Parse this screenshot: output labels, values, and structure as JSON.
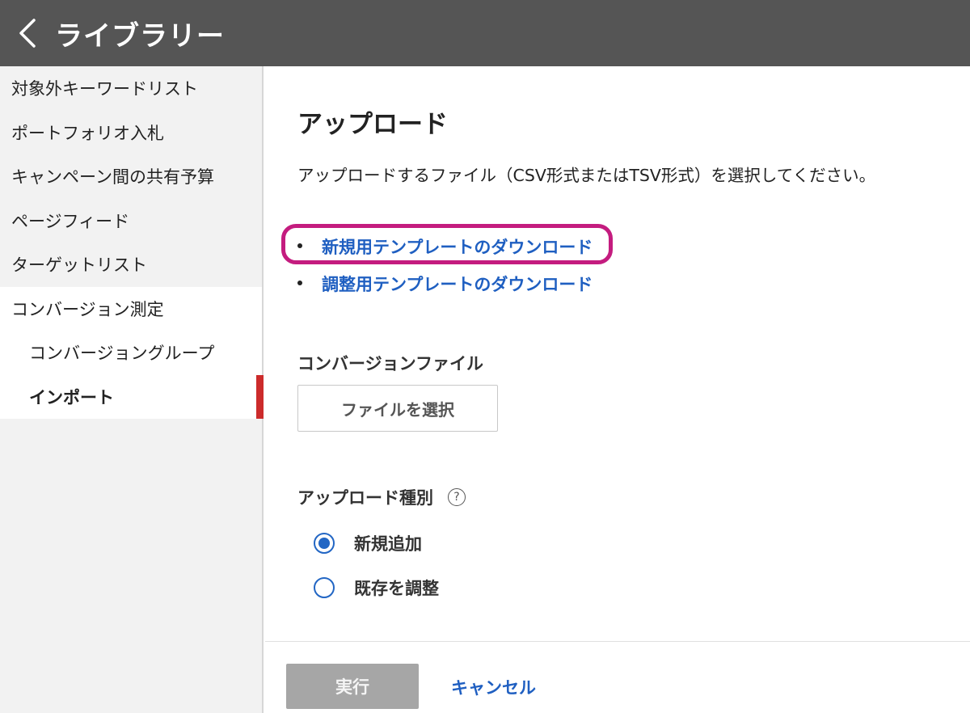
{
  "header": {
    "title": "ライブラリー"
  },
  "sidebar": {
    "items": [
      {
        "label": "対象外キーワードリスト"
      },
      {
        "label": "ポートフォリオ入札"
      },
      {
        "label": "キャンペーン間の共有予算"
      },
      {
        "label": "ページフィード"
      },
      {
        "label": "ターゲットリスト"
      },
      {
        "label": "コンバージョン測定"
      },
      {
        "label": "コンバージョングループ"
      },
      {
        "label": "インポート"
      }
    ],
    "selected_color": "#cc2b2b"
  },
  "main": {
    "title": "アップロード",
    "description": "アップロードするファイル（CSV形式またはTSV形式）を選択してください。",
    "links": [
      {
        "label": "新規用テンプレートのダウンロード"
      },
      {
        "label": "調整用テンプレートのダウンロード"
      }
    ],
    "file_section": {
      "label": "コンバージョンファイル",
      "button_label": "ファイルを選択"
    },
    "upload_type": {
      "label": "アップロード種別",
      "help_glyph": "?",
      "options": [
        {
          "label": "新規追加",
          "selected": true
        },
        {
          "label": "既存を調整",
          "selected": false
        }
      ]
    },
    "footer": {
      "run_label": "実行",
      "cancel_label": "キャンセル"
    }
  },
  "colors": {
    "header_bg": "#555555",
    "link": "#1f5fc1",
    "highlight": "#c41c7f",
    "radio": "#2266c4"
  }
}
